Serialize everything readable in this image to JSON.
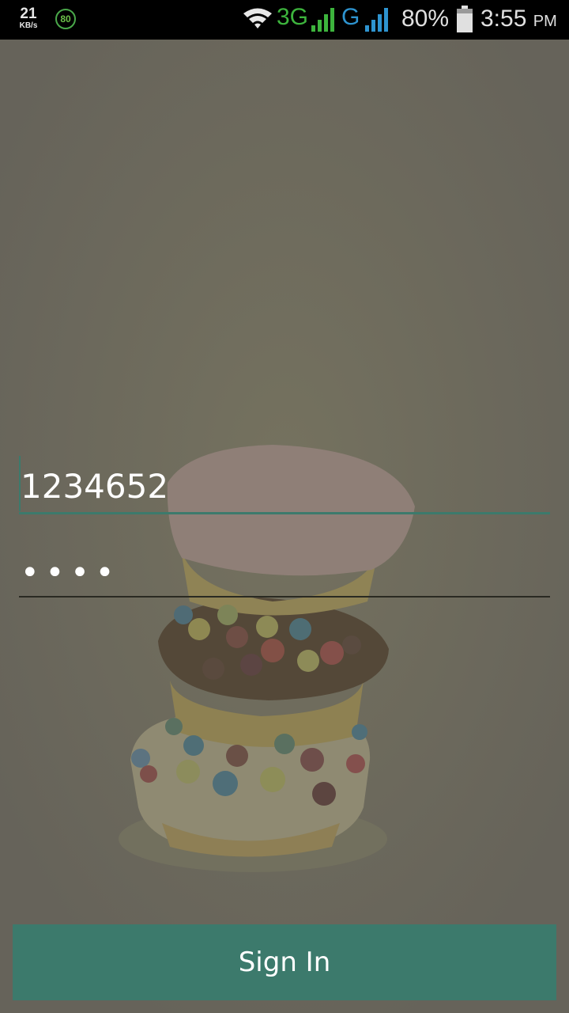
{
  "status_bar": {
    "net_speed_value": "21",
    "net_speed_unit": "KB/s",
    "cleaner_badge": "80",
    "network_3g": "3G",
    "network_g": "G",
    "battery_percent": "80%",
    "time": "3:55",
    "ampm": "PM",
    "icons": [
      "wifi-icon",
      "signal-icon",
      "signal-icon",
      "battery-icon"
    ],
    "colors": {
      "net_3g": "#3db43d",
      "net_g": "#2e94d0",
      "cleaner": "#4aa84a"
    }
  },
  "login": {
    "username_value": "1234652",
    "password_value": "1234",
    "sign_in_label": "Sign In"
  },
  "colors": {
    "accent": "#3c7a6c",
    "overlay": "#6a675a"
  }
}
